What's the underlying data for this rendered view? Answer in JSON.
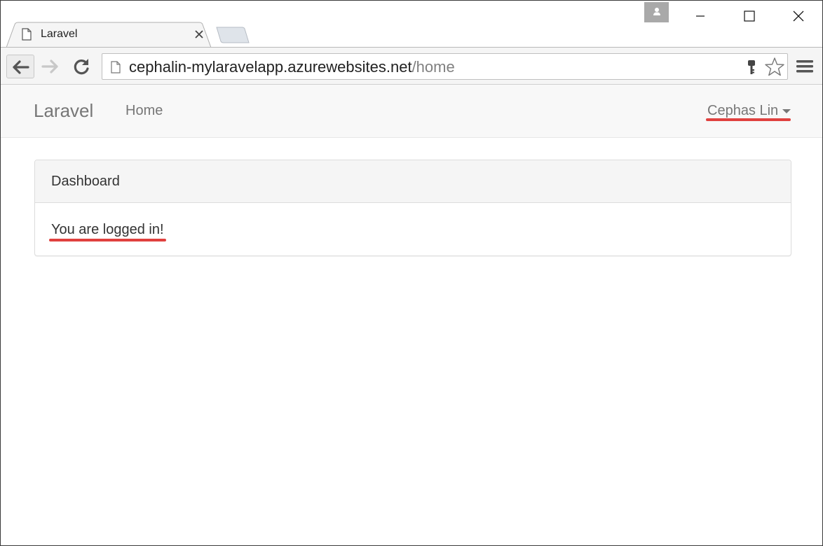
{
  "browser": {
    "tab": {
      "title": "Laravel"
    },
    "address": {
      "host": "cephalin-mylaravelapp.azurewebsites.net",
      "path": "/home"
    },
    "icons": {
      "tab_favicon": "page-icon",
      "tab_close": "close-icon",
      "profile": "person-icon",
      "back": "arrow-left-icon",
      "forward": "arrow-right-icon",
      "reload": "reload-icon",
      "key": "key-icon",
      "star": "star-icon",
      "menu": "hamburger-icon"
    }
  },
  "navbar": {
    "brand": "Laravel",
    "links": [
      {
        "label": "Home"
      }
    ],
    "user": "Cephas Lin"
  },
  "panel": {
    "heading": "Dashboard",
    "body": "You are logged in!"
  },
  "colors": {
    "annotation": "#e0413f",
    "navbar_bg": "#f8f8f8",
    "panel_heading_bg": "#f5f5f5"
  }
}
